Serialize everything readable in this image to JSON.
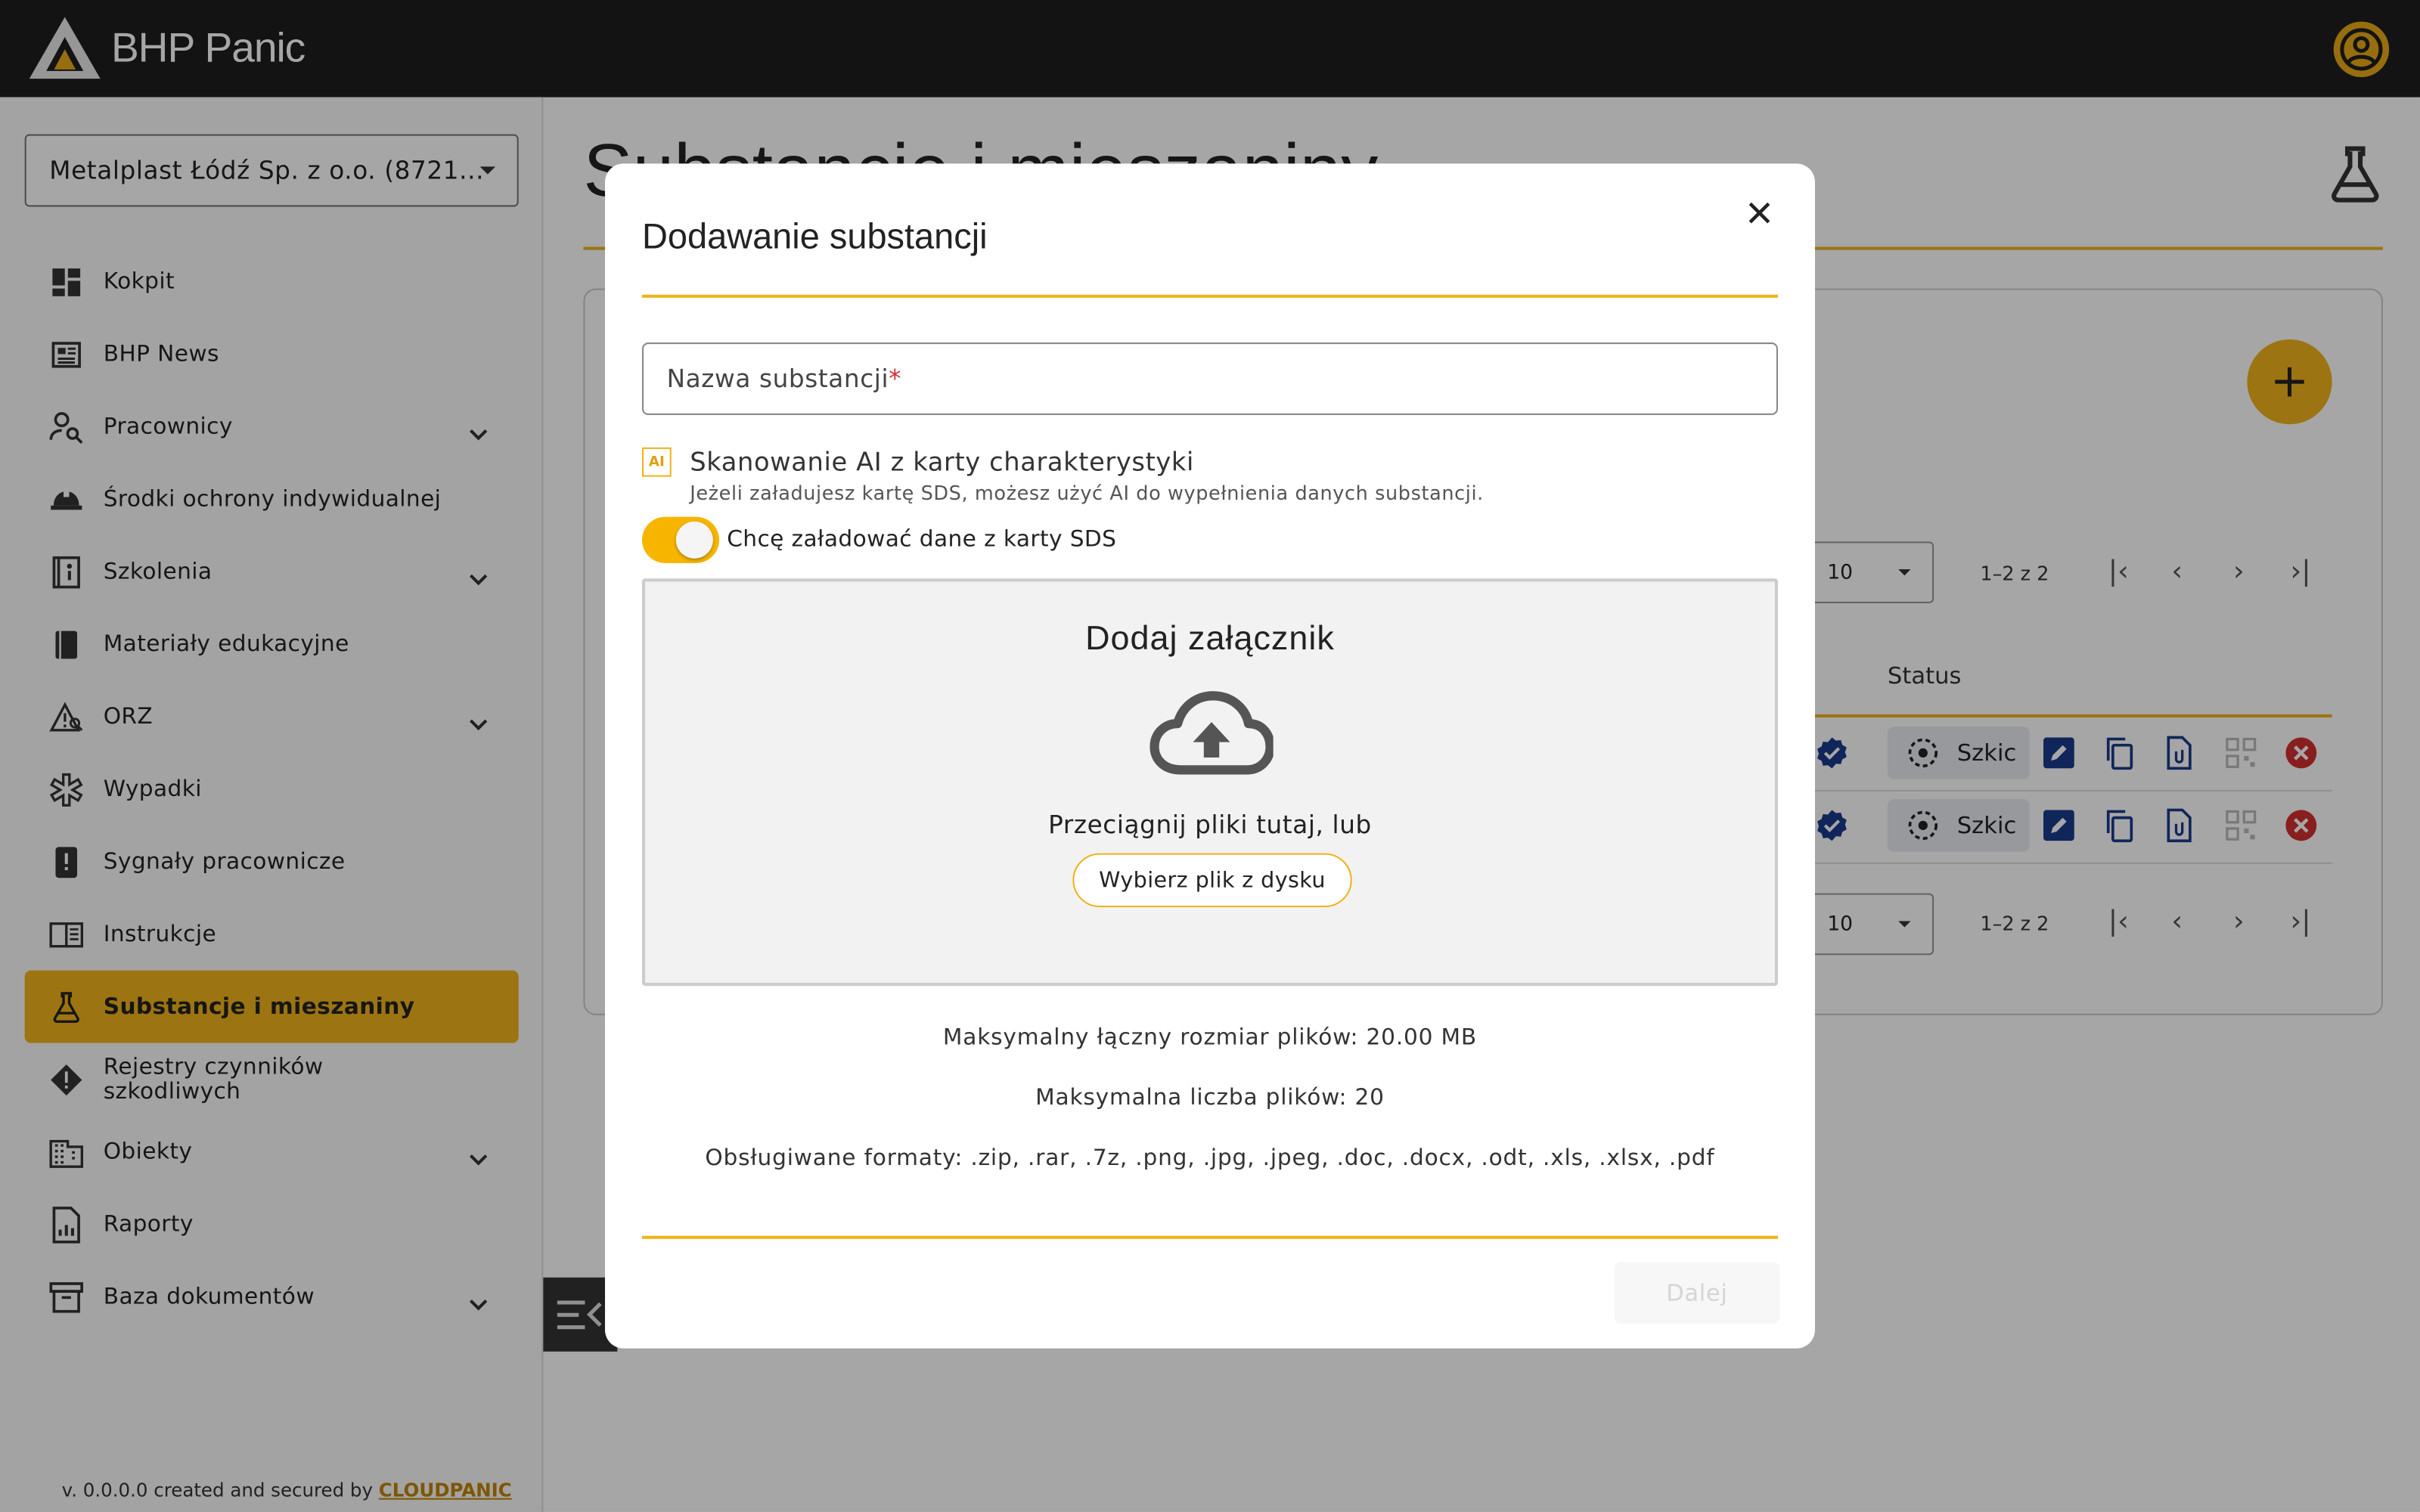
{
  "app": {
    "name": "BHP Panic"
  },
  "sidebar": {
    "company": "Metalplast Łódź Sp. z o.o. (8721...",
    "items": [
      {
        "label": "Kokpit",
        "icon": "dashboard-icon",
        "expandable": false
      },
      {
        "label": "BHP News",
        "icon": "newspaper-icon",
        "expandable": false
      },
      {
        "label": "Pracownicy",
        "icon": "person-search-icon",
        "expandable": true
      },
      {
        "label": "Środki ochrony indywidualnej",
        "icon": "helmet-icon",
        "expandable": false
      },
      {
        "label": "Szkolenia",
        "icon": "training-book-icon",
        "expandable": true
      },
      {
        "label": "Materiały edukacyjne",
        "icon": "book-icon",
        "expandable": false
      },
      {
        "label": "ORZ",
        "icon": "risk-warning-icon",
        "expandable": true
      },
      {
        "label": "Wypadki",
        "icon": "medical-star-icon",
        "expandable": false
      },
      {
        "label": "Sygnały pracownicze",
        "icon": "signal-phone-icon",
        "expandable": false
      },
      {
        "label": "Instrukcje",
        "icon": "instructions-icon",
        "expandable": false
      },
      {
        "label": "Substancje i mieszaniny",
        "icon": "flask-icon",
        "expandable": false,
        "active": true
      },
      {
        "label": "Rejestry czynników szkodliwych",
        "icon": "warning-diamond-icon",
        "expandable": false
      },
      {
        "label": "Obiekty",
        "icon": "building-icon",
        "expandable": true
      },
      {
        "label": "Raporty",
        "icon": "report-icon",
        "expandable": false
      },
      {
        "label": "Baza dokumentów",
        "icon": "archive-icon",
        "expandable": true
      }
    ],
    "footer_prefix": "v. 0.0.0.0 created and secured by",
    "footer_brand": "CLOUDPANIC"
  },
  "main": {
    "title": "Substancje i mieszaniny",
    "add_label": "+",
    "pagination": {
      "per_page": "10",
      "range": "1–2 z 2"
    },
    "status_header": "Status",
    "rows": [
      {
        "status": "Szkic"
      },
      {
        "status": "Szkic"
      }
    ]
  },
  "modal": {
    "title": "Dodawanie substancji",
    "name_placeholder": "Nazwa substancji",
    "required_mark": "*",
    "ai_badge": "AI",
    "ai_title": "Skanowanie AI z karty charakterystyki",
    "ai_description": "Jeżeli załadujesz kartę SDS, możesz użyć AI do wypełnienia danych substancji.",
    "toggle_label": "Chcę załadować dane z karty SDS",
    "toggle_on": true,
    "dropzone": {
      "title": "Dodaj załącznik",
      "drag_text": "Przeciągnij pliki tutaj, lub",
      "button": "Wybierz plik z dysku"
    },
    "max_size": "Maksymalny łączny rozmiar plików: 20.00 MB",
    "max_count": "Maksymalna liczba plików: 20",
    "formats": "Obsługiwane formaty: .zip, .rar, .7z, .png, .jpg, .jpeg, .doc, .docx, .odt, .xls, .xlsx, .pdf",
    "next_button": "Dalej"
  },
  "colors": {
    "accent": "#f0b21b",
    "topbar": "#1e1e1e",
    "overlay": "rgba(0,0,0,0.35)"
  }
}
